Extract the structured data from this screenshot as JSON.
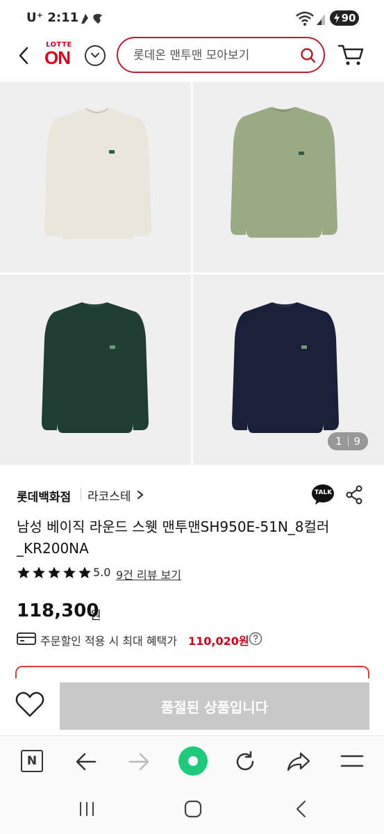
{
  "status_bar": {
    "carrier_time": "U⁺ 2:11",
    "battery": "90"
  },
  "header": {
    "logo_top": "LOTTE",
    "logo_main": "ON",
    "search_placeholder": "롯데온 맨투맨 모아보기"
  },
  "gallery": {
    "counter_current": "1",
    "counter_total": "9",
    "colors": [
      "#ebe6dc",
      "#9aaa84",
      "#1f3d33",
      "#192038"
    ]
  },
  "product": {
    "brand": "롯데백화점",
    "sub_brand": "라코스테",
    "title": "남성 베이직 라운드 스웻 맨투맨SH950E-51N_8컬러 _KR200NA",
    "rating": 5.0,
    "rating_text": "5.0",
    "review_link": "9건 리뷰 보기",
    "price": "118,300",
    "price_unit": "원",
    "benefit_label": "주문할인 적용 시 최대 혜택가",
    "benefit_amount": "110,020원"
  },
  "actions": {
    "soldout_label": "품절된 상품입니다",
    "kakao_label": "TALK"
  },
  "browser_toolbar": {
    "n_label": "N"
  }
}
